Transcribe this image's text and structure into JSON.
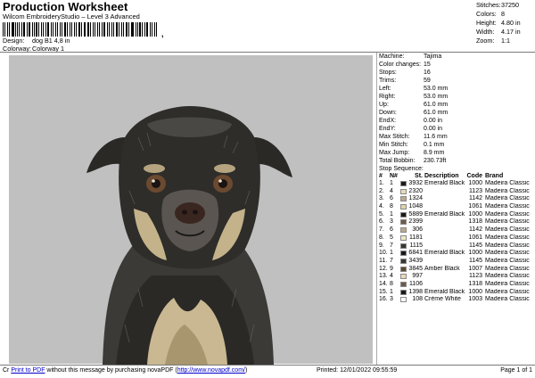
{
  "header": {
    "title": "Production Worksheet",
    "subtitle": "Wilcom EmbroideryStudio – Level 3 Advanced",
    "barcode_mark": ",",
    "design_label": "Design:",
    "design_value": "dog B1 4,8 in",
    "colorway_label": "Colorway:",
    "colorway_value": "Colorway 1"
  },
  "stats": [
    {
      "k": "Stitches:",
      "v": "37250"
    },
    {
      "k": "Colors:",
      "v": "8"
    },
    {
      "k": "Height:",
      "v": "4.80 in"
    },
    {
      "k": "Width:",
      "v": "4.17 in"
    },
    {
      "k": "Zoom:",
      "v": "1:1"
    }
  ],
  "details": [
    {
      "k": "Machine:",
      "v": "Tajima"
    },
    {
      "k": "Color changes:",
      "v": "15"
    },
    {
      "k": "Stops:",
      "v": "16"
    },
    {
      "k": "Trims:",
      "v": "59"
    },
    {
      "k": "Left:",
      "v": "53.0 mm"
    },
    {
      "k": "Right:",
      "v": "53.0 mm"
    },
    {
      "k": "Up:",
      "v": "61.0 mm"
    },
    {
      "k": "Down:",
      "v": "61.0 mm"
    },
    {
      "k": "EndX:",
      "v": "0.00 in"
    },
    {
      "k": "EndY:",
      "v": "0.00 in"
    },
    {
      "k": "Max Stitch:",
      "v": "11.6 mm"
    },
    {
      "k": "Min Stitch:",
      "v": "0.1 mm"
    },
    {
      "k": "Max Jump:",
      "v": "8.9 mm"
    },
    {
      "k": "Total Bobbin:",
      "v": "230.73ft"
    },
    {
      "k": "Stop Sequence:",
      "v": ""
    }
  ],
  "stop_headers": {
    "n": "#",
    "n2": "N#",
    "st": "St.",
    "desc": "Description",
    "code": "Code",
    "brand": "Brand"
  },
  "stops": [
    {
      "n": "1.",
      "i": "1",
      "color": "#1a1a1a",
      "st": "3932",
      "desc": "Emerald Black",
      "code": "1000",
      "brand": "Madeira Classic 40"
    },
    {
      "n": "2.",
      "i": "4",
      "color": "#e8d9b8",
      "st": "2320",
      "desc": "",
      "code": "1123",
      "brand": "Madeira Classic 40"
    },
    {
      "n": "3.",
      "i": "6",
      "color": "#b8a890",
      "st": "1324",
      "desc": "",
      "code": "1142",
      "brand": "Madeira Classic 40"
    },
    {
      "n": "4.",
      "i": "8",
      "color": "#e0d2aa",
      "st": "1048",
      "desc": "",
      "code": "1061",
      "brand": "Madeira Classic 40"
    },
    {
      "n": "5.",
      "i": "1",
      "color": "#1a1a1a",
      "st": "5889",
      "desc": "Emerald Black",
      "code": "1000",
      "brand": "Madeira Classic 40"
    },
    {
      "n": "6.",
      "i": "3",
      "color": "#6e5a4a",
      "st": "2399",
      "desc": "",
      "code": "1318",
      "brand": "Madeira Classic 40"
    },
    {
      "n": "7.",
      "i": "6",
      "color": "#b8a890",
      "st": "306",
      "desc": "",
      "code": "1142",
      "brand": "Madeira Classic 40"
    },
    {
      "n": "8.",
      "i": "5",
      "color": "#f0e6c8",
      "st": "1181",
      "desc": "",
      "code": "1061",
      "brand": "Madeira Classic 40"
    },
    {
      "n": "9.",
      "i": "7",
      "color": "#3a3530",
      "st": "1115",
      "desc": "",
      "code": "1145",
      "brand": "Madeira Classic 40"
    },
    {
      "n": "10.",
      "i": "1",
      "color": "#1a1a1a",
      "st": "6841",
      "desc": "Emerald Black",
      "code": "1000",
      "brand": "Madeira Classic 40"
    },
    {
      "n": "11.",
      "i": "7",
      "color": "#3a3530",
      "st": "3439",
      "desc": "",
      "code": "1145",
      "brand": "Madeira Classic 40"
    },
    {
      "n": "12.",
      "i": "9",
      "color": "#5a4a30",
      "st": "3845",
      "desc": "Amber Black",
      "code": "1007",
      "brand": "Madeira Classic 40"
    },
    {
      "n": "13.",
      "i": "4",
      "color": "#e8d9b8",
      "st": "997",
      "desc": "",
      "code": "1123",
      "brand": "Madeira Classic 40"
    },
    {
      "n": "14.",
      "i": "8",
      "color": "#6e5a4a",
      "st": "1106",
      "desc": "",
      "code": "1318",
      "brand": "Madeira Classic 40"
    },
    {
      "n": "15.",
      "i": "1",
      "color": "#1a1a1a",
      "st": "1398",
      "desc": "Emerald Black",
      "code": "1000",
      "brand": "Madeira Classic 40"
    },
    {
      "n": "16.",
      "i": "3",
      "color": "#ffffff",
      "st": "108",
      "desc": "Crème White",
      "code": "1003",
      "brand": "Madeira Classic 40"
    }
  ],
  "footer": {
    "prefix": "Cr",
    "link1": "Print to PDF",
    "middle": " without this message by purchasing novaPDF (",
    "link2": "http://www.novapdf.com/",
    "suffix": ")",
    "printed": "Printed: 12/01/2022 09:55:59",
    "page": "Page 1 of 1"
  },
  "colors": {
    "preview_bg": "#c0c0c0"
  }
}
